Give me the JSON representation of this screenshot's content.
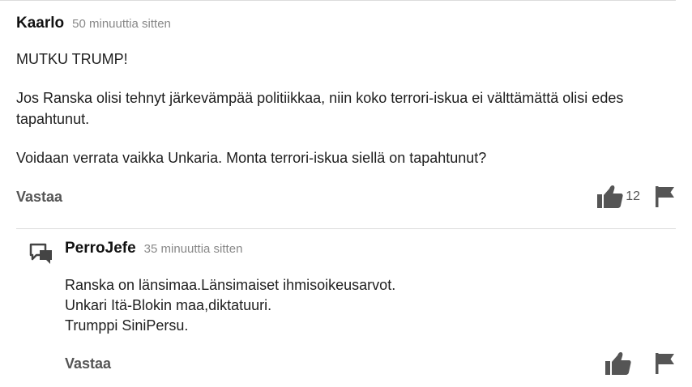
{
  "comments": [
    {
      "author": "Kaarlo",
      "time": "50 minuuttia sitten",
      "paragraphs": [
        "MUTKU TRUMP!",
        "Jos Ranska olisi tehnyt järkevämpää politiikkaa, niin koko terrori-iskua ei välttämättä olisi edes tapahtunut.",
        "Voidaan verrata vaikka Unkaria. Monta terrori-iskua siellä on tapahtunut?"
      ],
      "reply_label": "Vastaa",
      "likes": "12"
    },
    {
      "author": "PerroJefe",
      "time": "35 minuuttia sitten",
      "lines": [
        "Ranska on länsimaa.Länsimaiset ihmisoikeusarvot.",
        "Unkari Itä-Blokin maa,diktatuuri.",
        "Trumppi SiniPersu."
      ],
      "reply_label": "Vastaa"
    }
  ],
  "icons": {
    "like": "thumbs-up-icon",
    "flag": "flag-icon",
    "reply_thread": "speech-bubbles-icon"
  },
  "colors": {
    "icon": "#555555",
    "divider": "#dcdcdc",
    "muted_text": "#888888"
  }
}
